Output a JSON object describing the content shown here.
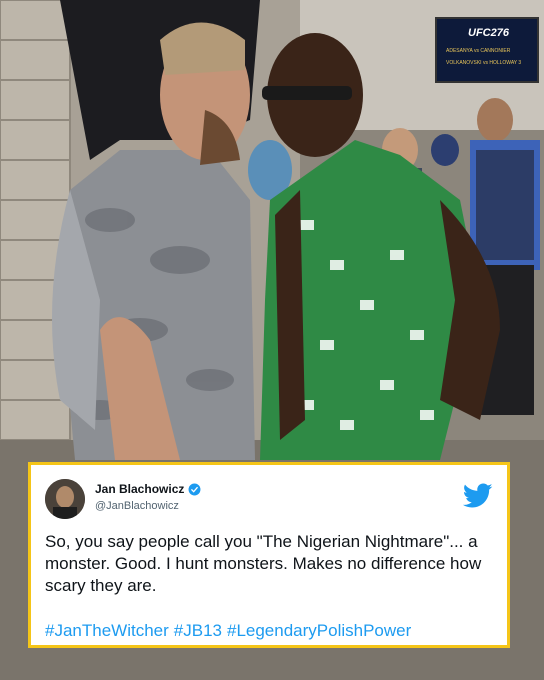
{
  "scene": {
    "description_icon": "photo-faceoff",
    "banner": {
      "logo": "UFC 276",
      "lines": [
        "ADESANYA vs CANNONIER",
        "VOLKANOVSKI vs HOLLOWAY 3"
      ]
    }
  },
  "tweet": {
    "author_name": "Jan Blachowicz",
    "author_handle": "@JanBlachowicz",
    "verified_icon": "verified-badge-icon",
    "platform_icon": "twitter-bird-icon",
    "text": "So, you say people call you \"The  Nigerian Nightmare\"... a monster.  Good. I hunt monsters. Makes no difference how scary they are.",
    "hashtags": [
      "#JanTheWitcher",
      "#JB13",
      "#LegendaryPolishPower"
    ],
    "colors": {
      "border": "#f5c518",
      "link": "#1d9bf0",
      "bird": "#1d9bf0"
    }
  }
}
